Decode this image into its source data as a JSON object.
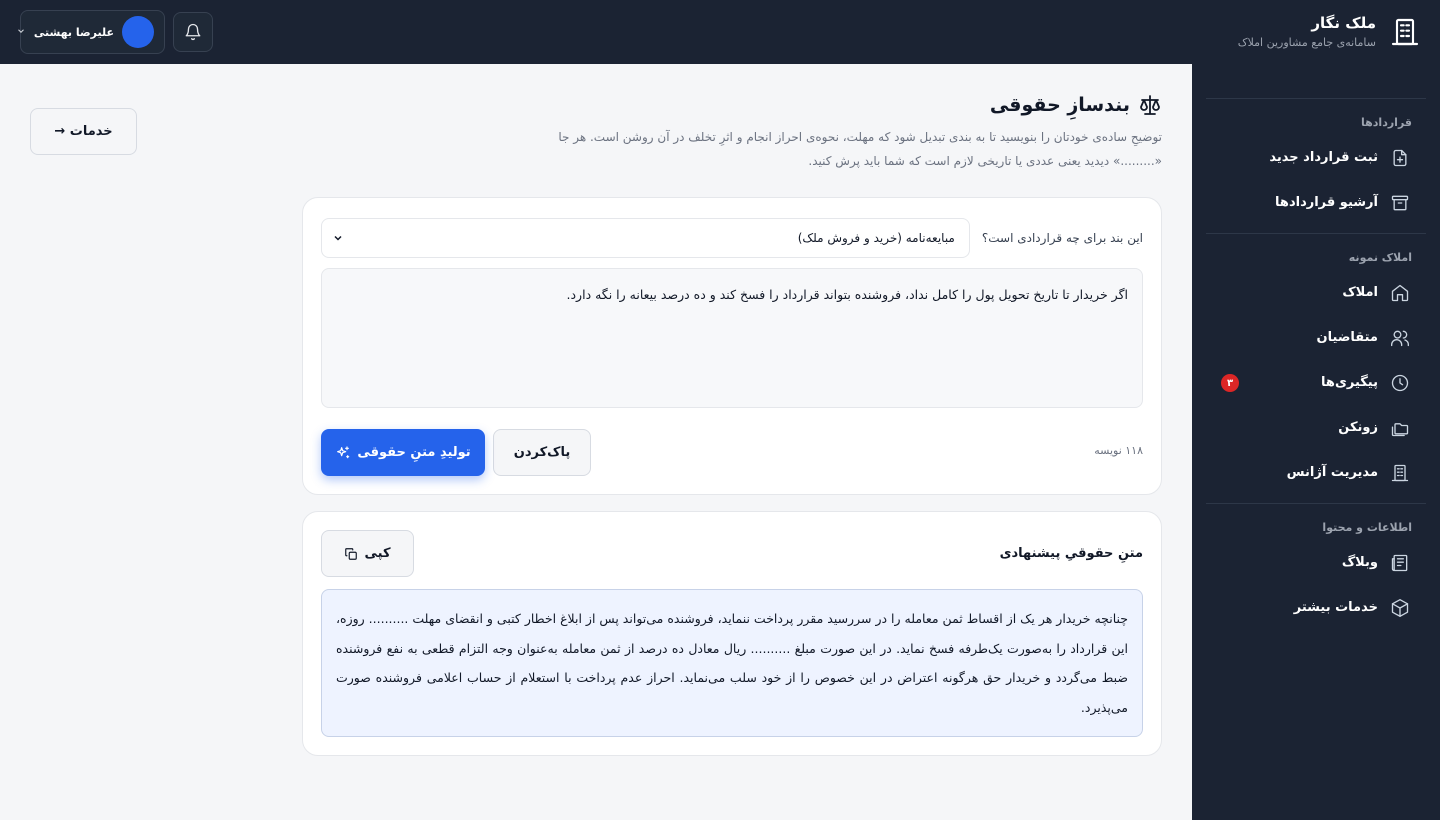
{
  "brand": {
    "title": "ملک نگار",
    "subtitle": "سامانه‌ی جامع مشاورین املاک"
  },
  "user": {
    "name": "علیرضا بهشتی"
  },
  "sidebar": {
    "sections": [
      {
        "heading": "قراردادها",
        "items": [
          {
            "label": "ثبت قرارداد جدید",
            "icon": "file-plus-icon"
          },
          {
            "label": "آرشیو قراردادها",
            "icon": "archive-icon"
          }
        ]
      },
      {
        "heading": "املاک نمونه",
        "items": [
          {
            "label": "املاک",
            "icon": "home-icon"
          },
          {
            "label": "متقاضیان",
            "icon": "users-icon"
          },
          {
            "label": "پیگیری‌ها",
            "icon": "clock-icon",
            "badge": "۳"
          },
          {
            "label": "زونکن",
            "icon": "folders-icon"
          },
          {
            "label": "مدیریت آژانس",
            "icon": "building-icon"
          }
        ]
      },
      {
        "heading": "اطلاعات و محتوا",
        "items": [
          {
            "label": "وبلاگ",
            "icon": "newspaper-icon"
          },
          {
            "label": "خدمات بیشتر",
            "icon": "box-icon"
          }
        ]
      }
    ]
  },
  "main": {
    "back_label": "خدمات →",
    "title": "بندسازِ حقوقی",
    "description_line1": "توضیحِ ساده‌ی خودتان را بنویسید تا به بندی تبدیل شود که مهلت، نحوه‌ی احراز انجام و اثرِ تخلف در آن روشن است. هر جا",
    "description_line2": "«.........» دیدید یعنی عددی یا تاریخی لازم است که شما باید پرش کنید."
  },
  "form": {
    "question_label": "این بند برای چه قراردادی است؟",
    "selected_contract": "مبایعه‌نامه (خرید و فروش ملک)",
    "input_text": "اگر خریدار تا تاریخ تحویل پول را کامل نداد، فروشنده بتواند قرارداد را فسخ کند و ده درصد بیعانه را نگه دارد.",
    "char_count": "۱۱۸ نویسه",
    "clear_label": "پاک‌کردن",
    "generate_label": "تولیدِ متنِ حقوقی"
  },
  "result": {
    "title": "متنِ حقوقیِ پیشنهادی",
    "copy_label": "کپی",
    "text": "چنانچه خریدار هر یک از اقساط ثمن معامله را در سررسید مقرر پرداخت ننماید، فروشنده می‌تواند پس از ابلاغ اخطار کتبی و انقضای مهلت .......... روزه، این قرارداد را به‌صورت یک‌طرفه فسخ نماید. در این صورت مبلغ .......... ریال معادل ده درصد از ثمن معامله به‌عنوان وجه التزام قطعی به نفع فروشنده ضبط می‌گردد و خریدار حق هرگونه اعتراض در این خصوص را از خود سلب می‌نماید. احراز عدم پرداخت با استعلام از حساب اعلامی فروشنده صورت می‌پذیرد."
  },
  "colors": {
    "accent": "#2563eb",
    "sidebar_bg": "#1b2333",
    "badge": "#dc2626"
  }
}
